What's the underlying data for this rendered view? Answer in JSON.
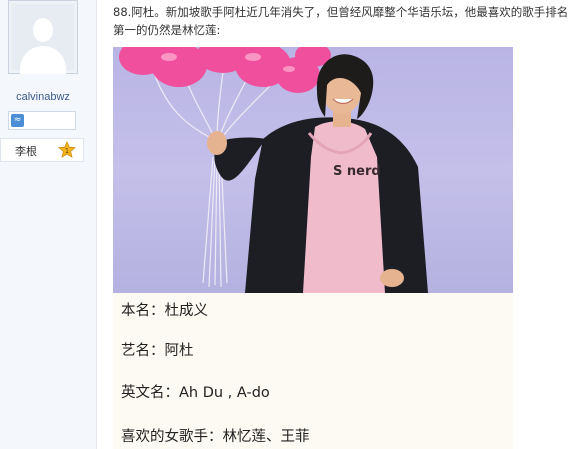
{
  "sidebar": {
    "username": "calvinabwz",
    "rank_label": "李根",
    "medal_number": "1",
    "level_icon": "wave-icon",
    "avatar_icon": "default-user-avatar-icon"
  },
  "post": {
    "intro": "88.阿杜。新加坡歌手阿杜近几年消失了，但曾经风靡整个华语乐坛，他最喜欢的歌手排名第一的仍然是林忆莲:",
    "shirt_text": "S nerd",
    "info": [
      "本名：杜成义",
      "艺名：阿杜",
      "英文名：Ah Du , A-do",
      "喜欢的女歌手：林忆莲、王菲"
    ]
  },
  "colors": {
    "sidebar_bg": "#f4f7fb",
    "username": "#3b5a8a",
    "photo_bg": "#b9b4e4",
    "balloon_pink": "#ef4f9c",
    "info_bg": "#fdf9f3",
    "medal_gold": "#f2b51d"
  }
}
